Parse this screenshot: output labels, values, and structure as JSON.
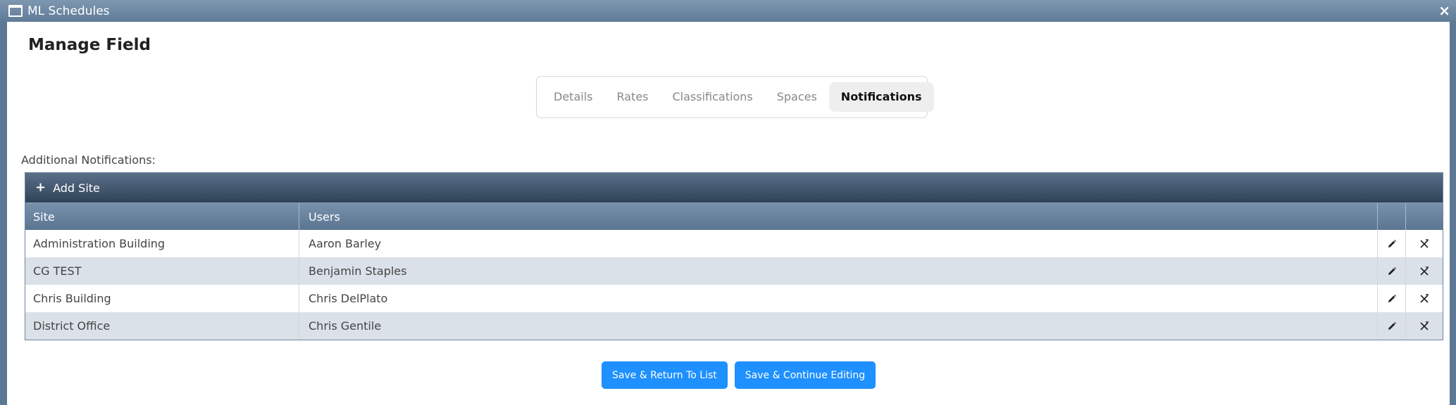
{
  "window": {
    "title": "ML Schedules",
    "close_glyph": "×"
  },
  "page": {
    "title": "Manage Field"
  },
  "tabs": [
    {
      "label": "Details",
      "active": false
    },
    {
      "label": "Rates",
      "active": false
    },
    {
      "label": "Classifications",
      "active": false
    },
    {
      "label": "Spaces",
      "active": false
    },
    {
      "label": "Notifications",
      "active": true
    }
  ],
  "section": {
    "label": "Additional Notifications:"
  },
  "grid": {
    "toolbar": {
      "add_label": "Add Site",
      "add_icon": "plus-icon"
    },
    "columns": [
      "Site",
      "Users"
    ],
    "rows": [
      {
        "site": "Administration Building",
        "users": "Aaron Barley"
      },
      {
        "site": "CG TEST",
        "users": "Benjamin Staples"
      },
      {
        "site": "Chris Building",
        "users": "Chris DelPlato"
      },
      {
        "site": "District Office",
        "users": "Chris Gentile"
      }
    ]
  },
  "buttons": {
    "save_return": "Save & Return To List",
    "save_continue": "Save & Continue Editing"
  },
  "colors": {
    "accent": "#1e90ff",
    "header": "#5b7591",
    "toolbar": "#2f4257",
    "row_alt": "#dbe1e8"
  }
}
